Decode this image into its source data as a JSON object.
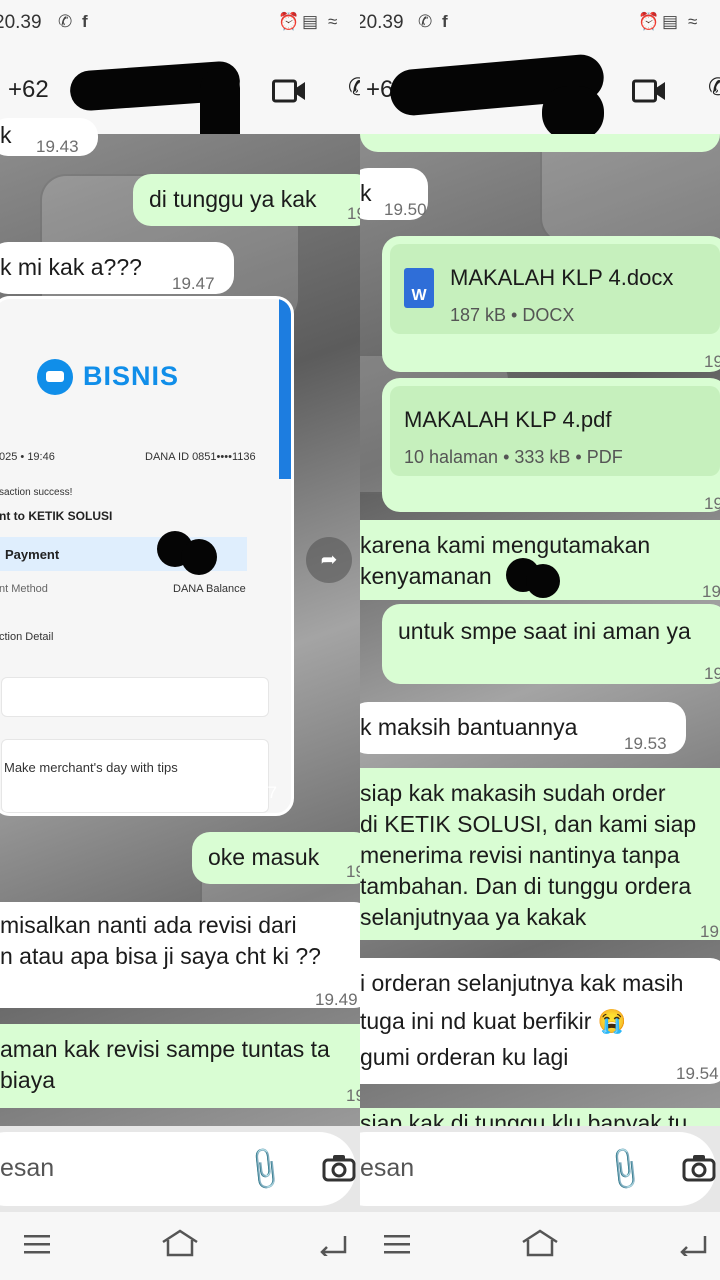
{
  "status_bar": {
    "time": "20.39"
  },
  "header": {
    "phone_left": "+62",
    "phone_right": "+6"
  },
  "left": {
    "top_bubble": {
      "text": "k",
      "time": "19.43"
    },
    "msg_wait": {
      "text": "di tunggu ya kak",
      "time": "19"
    },
    "msg_q": {
      "text": "k mi kak a???",
      "time": "19.47"
    },
    "receipt": {
      "brand": "BISNIS",
      "date": "025 • 19:46",
      "dana_id": "DANA ID 0851••••1136",
      "status": "saction success!",
      "to": "nt to KETIK SOLUSI",
      "payment": "Payment",
      "method_label": "nt Method",
      "method_value": "DANA Balance",
      "detail": "ction Detail",
      "tips": "Make merchant's day with tips",
      "time": "19.47"
    },
    "msg_masuk": {
      "text": "oke masuk",
      "time": "19"
    },
    "msg_revisi": {
      "line1": " misalkan nanti ada revisi dari",
      "line2": "n atau apa bisa ji saya cht ki ??",
      "time": "19.49"
    },
    "msg_aman": {
      "line1": "aman kak revisi sampe tuntas ta",
      "line2": "biaya",
      "time": "19"
    }
  },
  "right": {
    "top_bubble": {
      "text": "k",
      "time": "19.50"
    },
    "doc_docx": {
      "title": "MAKALAH KLP 4.docx",
      "meta": "187 kB • DOCX",
      "time": "19"
    },
    "doc_pdf": {
      "title": "MAKALAH KLP 4.pdf",
      "meta": "10 halaman • 333 kB • PDF",
      "time": "19"
    },
    "msg_kenyamanan": {
      "line1": "karena kami mengutamakan",
      "line2": "kenyamanan",
      "time": "19"
    },
    "msg_aman": {
      "text": "untuk smpe saat ini aman ya",
      "time": "19"
    },
    "msg_maksih": {
      "text": "k maksih bantuannya",
      "time": "19.53"
    },
    "msg_siap": {
      "line1": "siap kak makasih sudah order",
      "line2": "di KETIK SOLUSI, dan kami siap",
      "line3": "menerima revisi nantinya tanpa",
      "line4": "tambahan. Dan di tunggu ordera",
      "line5": "selanjutnyaa ya kakak",
      "time": "19"
    },
    "msg_orderan": {
      "line1": "i orderan selanjutnya kak masih",
      "line2": "tuga ini nd kuat berfikir 😭",
      "line3": "gumi orderan ku lagi",
      "time": "19.54"
    },
    "msg_cut": {
      "text": "siap kak di tunggu klu banyak tu"
    }
  },
  "input": {
    "placeholder": "esan"
  },
  "colors": {
    "outgoing": "#d9fdd3",
    "incoming": "#ffffff",
    "brand": "#108ee9"
  }
}
